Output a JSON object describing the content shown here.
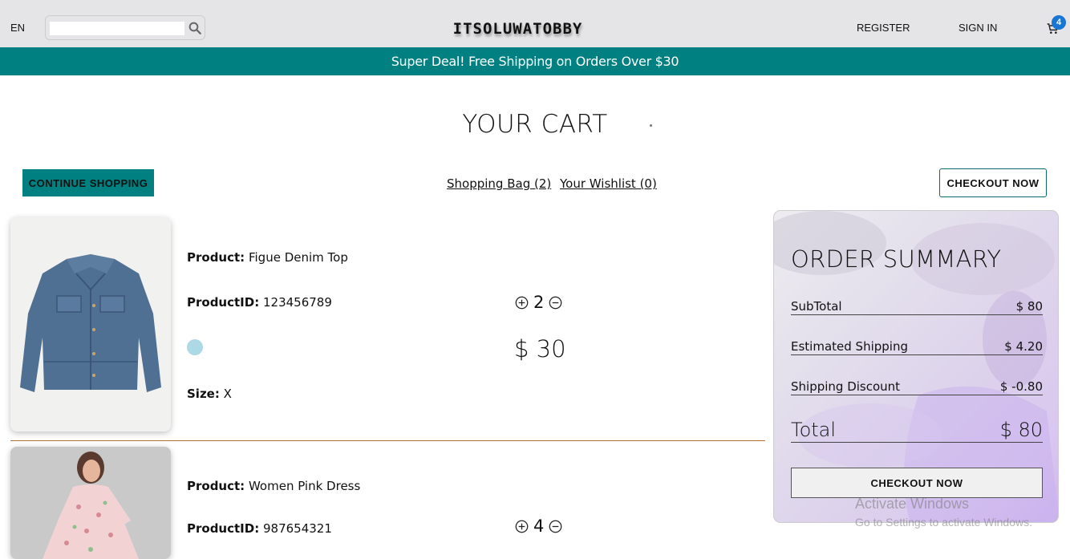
{
  "nav": {
    "lang": "EN",
    "search_placeholder": "",
    "logo": "ITSOLUWATOBBY",
    "register": "REGISTER",
    "sign_in": "SIGN IN",
    "cart_count": "4"
  },
  "announcement": "Super Deal! Free Shipping on Orders Over $30",
  "title": "YOUR CART",
  "actions": {
    "continue": "CONTINUE SHOPPING",
    "shopping_bag": "Shopping Bag (2)",
    "wishlist": "Your Wishlist (0)",
    "checkout": "CHECKOUT NOW"
  },
  "products": [
    {
      "product_label": "Product:",
      "product": "Figue Denim Top",
      "id_label": "ProductID:",
      "id": "123456789",
      "color": "#add8e6",
      "size_label": "Size:",
      "size": "X",
      "quantity": "2",
      "price": "$ 30"
    },
    {
      "product_label": "Product:",
      "product": "Women Pink Dress",
      "id_label": "ProductID:",
      "id": "987654321",
      "quantity": "4"
    }
  ],
  "summary": {
    "title": "ORDER SUMMARY",
    "subtotal_label": "SubTotal",
    "subtotal": "$ 80",
    "shipping_label": "Estimated Shipping",
    "shipping": "$ 4.20",
    "discount_label": "Shipping Discount",
    "discount": "$ -0.80",
    "total_label": "Total",
    "total": "$ 80",
    "checkout": "CHECKOUT NOW"
  },
  "watermark": {
    "line1": "Activate Windows",
    "line2": "Go to Settings to activate Windows."
  },
  "colors": {
    "teal": "#008080",
    "navbar_bg": "#e5e5e7",
    "badge": "#1976d2",
    "divider": "#b5702e"
  }
}
